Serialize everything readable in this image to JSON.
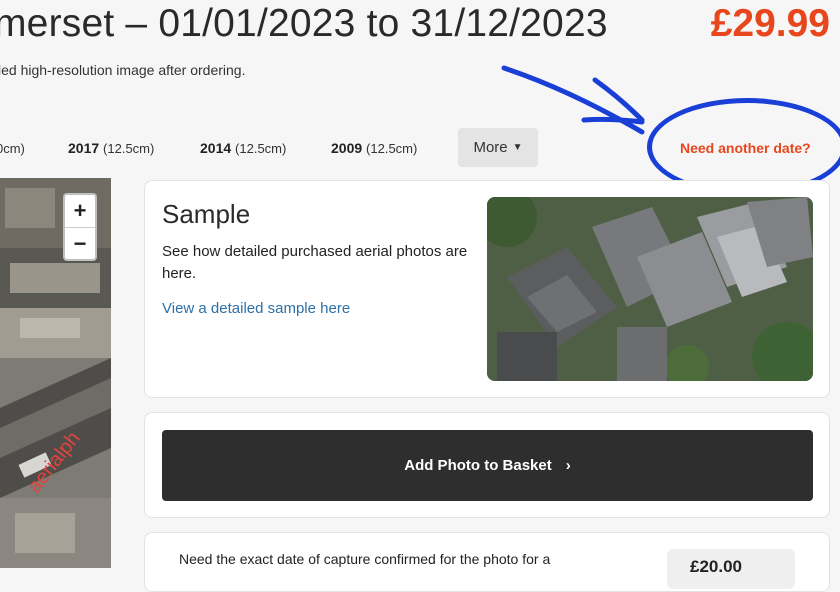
{
  "header": {
    "title": "merset – 01/01/2023 to 31/12/2023",
    "price": "£29.99",
    "subtitle": "led high-resolution image after ordering."
  },
  "dates": {
    "items": [
      {
        "year": "",
        "resolution": "0cm)"
      },
      {
        "year": "2017",
        "resolution": "(12.5cm)"
      },
      {
        "year": "2014",
        "resolution": "(12.5cm)"
      },
      {
        "year": "2009",
        "resolution": "(12.5cm)"
      }
    ],
    "more_label": "More",
    "need_another_date": "Need another date?"
  },
  "map": {
    "zoom_in": "+",
    "zoom_out": "−",
    "watermark": "aerialph"
  },
  "sample": {
    "title": "Sample",
    "description": "See how detailed purchased aerial photos are here.",
    "link": "View a detailed sample here"
  },
  "basket": {
    "button_label": "Add Photo to Basket",
    "chevron": "›"
  },
  "exact_date": {
    "text": "Need the exact date of capture confirmed for the photo for a",
    "price": "£20.00"
  },
  "colors": {
    "accent": "#e8461c",
    "annotation": "#1a3fd6",
    "button_dark": "#2e2e2e",
    "link": "#2f6fa8"
  }
}
